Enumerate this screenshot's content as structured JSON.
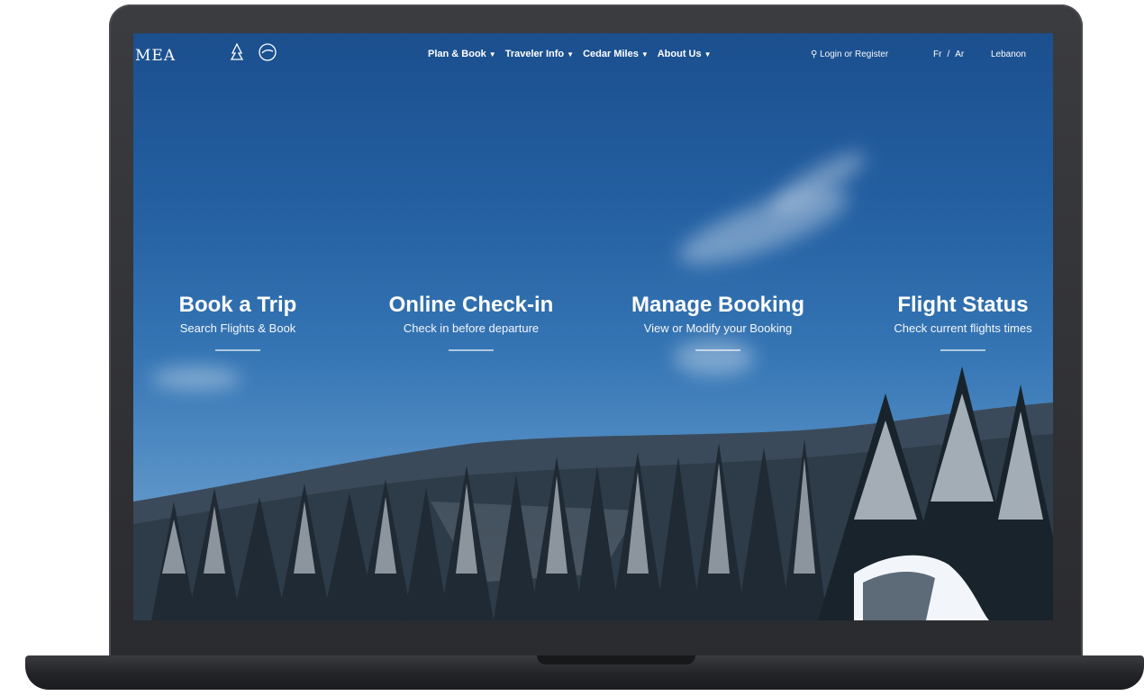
{
  "brand": {
    "logo_text": "MEA"
  },
  "nav": {
    "items": [
      {
        "label": "Plan & Book"
      },
      {
        "label": "Traveler Info"
      },
      {
        "label": "Cedar Miles"
      },
      {
        "label": "About Us"
      }
    ],
    "login": "Login or Register",
    "languages": [
      "Fr",
      "/",
      "Ar"
    ],
    "country": "Lebanon"
  },
  "tiles": [
    {
      "title": "Book a Trip",
      "subtitle": "Search Flights & Book"
    },
    {
      "title": "Online Check-in",
      "subtitle": "Check in before departure"
    },
    {
      "title": "Manage Booking",
      "subtitle": "View or Modify your Booking"
    },
    {
      "title": "Flight Status",
      "subtitle": "Check current flights times"
    }
  ],
  "colors": {
    "sky": "#2460a2",
    "bezel": "#2f3034",
    "text": "#ffffff"
  }
}
